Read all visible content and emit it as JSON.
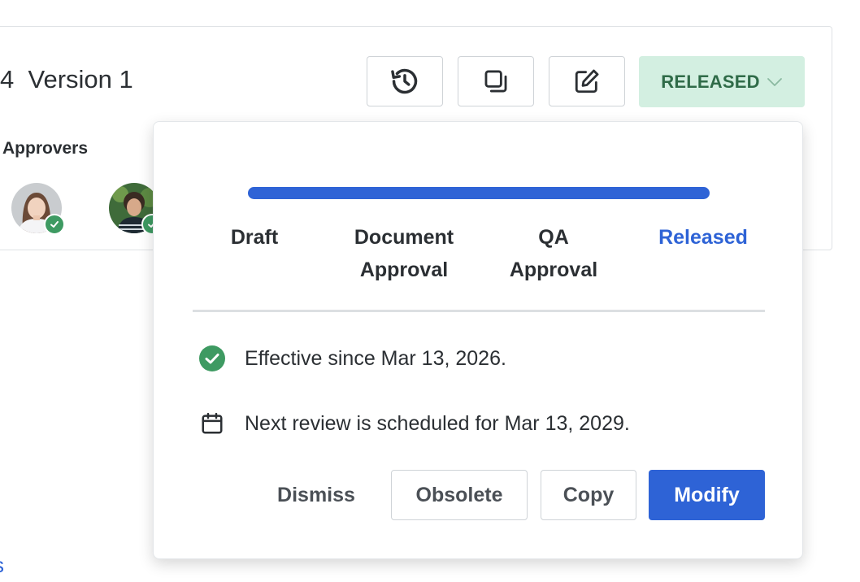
{
  "header": {
    "version_prefix": "4",
    "version_title": "Version 1",
    "approvers_label": "Approvers"
  },
  "toolbar": {
    "history_icon": "history-icon",
    "duplicate_icon": "duplicate-icon",
    "edit_icon": "edit-icon",
    "status_label": "RELEASED",
    "status_color": "#d3efe1"
  },
  "approvers": [
    {
      "name": "approver-1",
      "approved": true
    },
    {
      "name": "approver-2",
      "approved": true
    }
  ],
  "workflow": {
    "progress": 1.0,
    "steps": [
      {
        "line1": "Draft",
        "line2": ""
      },
      {
        "line1": "Document",
        "line2": "Approval"
      },
      {
        "line1": "QA",
        "line2": "Approval"
      },
      {
        "line1": "Released",
        "line2": ""
      }
    ],
    "active_step": 3
  },
  "info": {
    "effective_text": "Effective since Mar 13, 2026.",
    "review_text": "Next review is scheduled for Mar 13, 2029."
  },
  "actions": {
    "dismiss": "Dismiss",
    "obsolete": "Obsolete",
    "copy": "Copy",
    "modify": "Modify"
  },
  "corner_link": "s",
  "colors": {
    "accent": "#2e63d6",
    "success": "#3e9a62"
  }
}
